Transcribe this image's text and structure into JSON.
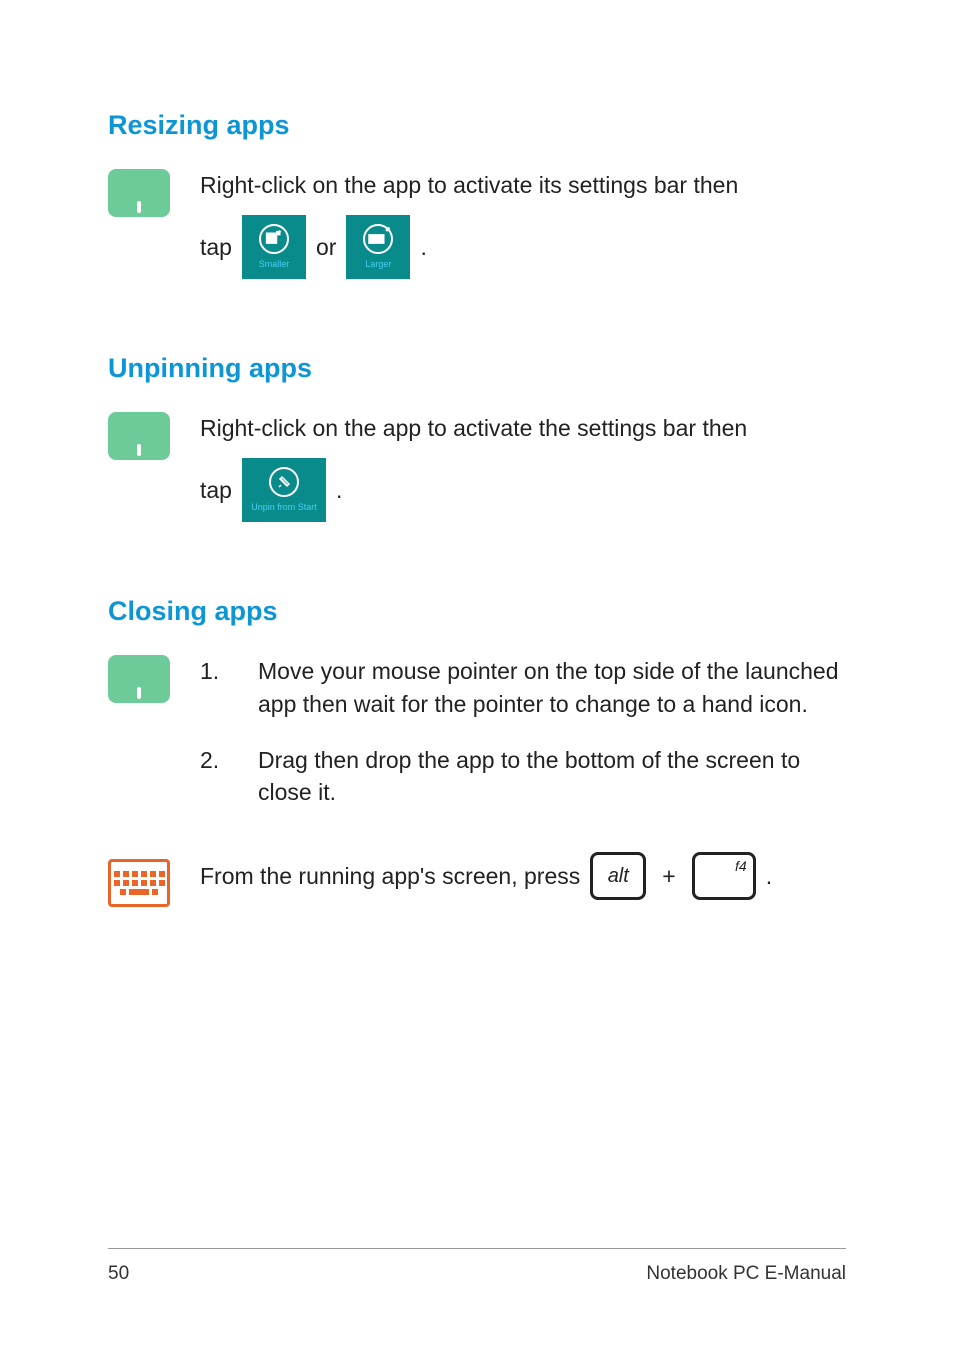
{
  "sections": {
    "resizing": {
      "heading": "Resizing apps",
      "text_line1": "Right-click on the app to activate its settings bar then",
      "tap": "tap",
      "or": "or",
      "period": ".",
      "tile_smaller": "Smaller",
      "tile_larger": "Larger"
    },
    "unpinning": {
      "heading": "Unpinning apps",
      "text_line1": "Right-click on the app to activate the settings bar then",
      "tap": "tap",
      "period": ".",
      "tile_unpin": "Unpin from Start"
    },
    "closing": {
      "heading": "Closing apps",
      "step1_num": "1.",
      "step1": "Move your mouse pointer on the top side of the launched app then wait for the pointer to change to a hand icon.",
      "step2_num": "2.",
      "step2": "Drag then drop the app to the bottom of the screen to close it.",
      "keyboard_text": "From the running app's screen, press",
      "key_alt": "alt",
      "plus": "+",
      "key_f4": "f4",
      "period": "."
    }
  },
  "footer": {
    "page_number": "50",
    "doc_title": "Notebook PC E-Manual"
  }
}
